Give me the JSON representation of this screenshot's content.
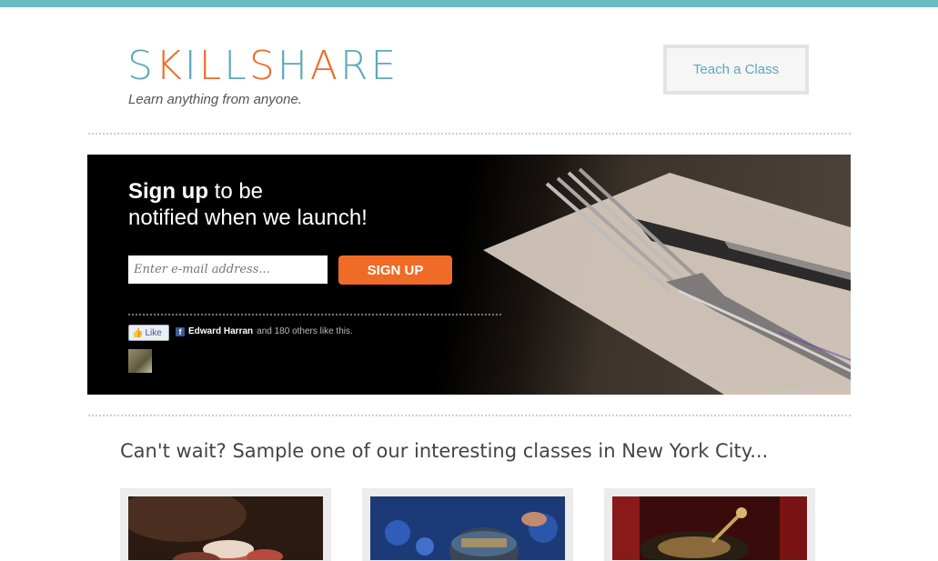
{
  "header": {
    "logo_parts": [
      "S",
      "K",
      "I",
      "L",
      "L",
      "S",
      "H",
      "A",
      "R",
      "E"
    ],
    "logo_colors": {
      "teal": "#5aa9b8",
      "orange": "#ee6a2a"
    },
    "tagline": "Learn anything from anyone.",
    "teach_button": "Teach a Class"
  },
  "hero": {
    "title_bold": "Sign up",
    "title_rest_1": " to be",
    "title_line_2": "notified when we launch!",
    "email_placeholder": "Enter e-mail address...",
    "signup_button": "SIGN UP",
    "like_button": "Like",
    "like_friend": "Edward Harran",
    "like_suffix": "and 180 others like this."
  },
  "sample": {
    "heading": "Can't wait? Sample one of our interesting classes in New York City..."
  },
  "colors": {
    "top_bar": "#6bbcc2",
    "signup_orange": "#f06b25",
    "link_teal": "#5aa9b8"
  }
}
